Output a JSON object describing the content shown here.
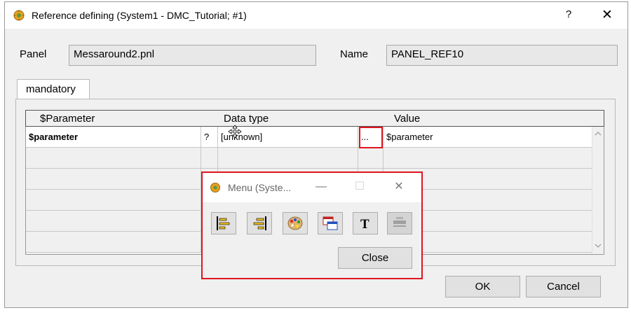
{
  "window": {
    "title": "Reference defining (System1 - DMC_Tutorial; #1)",
    "help_label": "?",
    "close_label": "✕"
  },
  "form": {
    "panel_label": "Panel",
    "panel_value": "Messaround2.pnl",
    "name_label": "Name",
    "name_value": "PANEL_REF10"
  },
  "tabs": [
    {
      "label": "mandatory",
      "selected": true
    }
  ],
  "table": {
    "headers": {
      "parameter": "$Parameter",
      "datatype": "Data type",
      "value": "Value"
    },
    "rows": [
      {
        "parameter": "$parameter",
        "flag": "?",
        "datatype": "[unknown]",
        "button": "...",
        "value": "$parameter"
      }
    ]
  },
  "menu_popup": {
    "title": "Menu (Syste...",
    "minimize_label": "—",
    "maximize_label": "☐",
    "close_label": "✕",
    "tools": [
      "align-left-icon",
      "align-right-icon",
      "color-palette-icon",
      "windows-icon",
      "text-icon",
      "disabled-tool-icon"
    ],
    "close_button": "Close"
  },
  "buttons": {
    "ok": "OK",
    "cancel": "Cancel"
  },
  "colors": {
    "highlight": "#e0141e"
  }
}
